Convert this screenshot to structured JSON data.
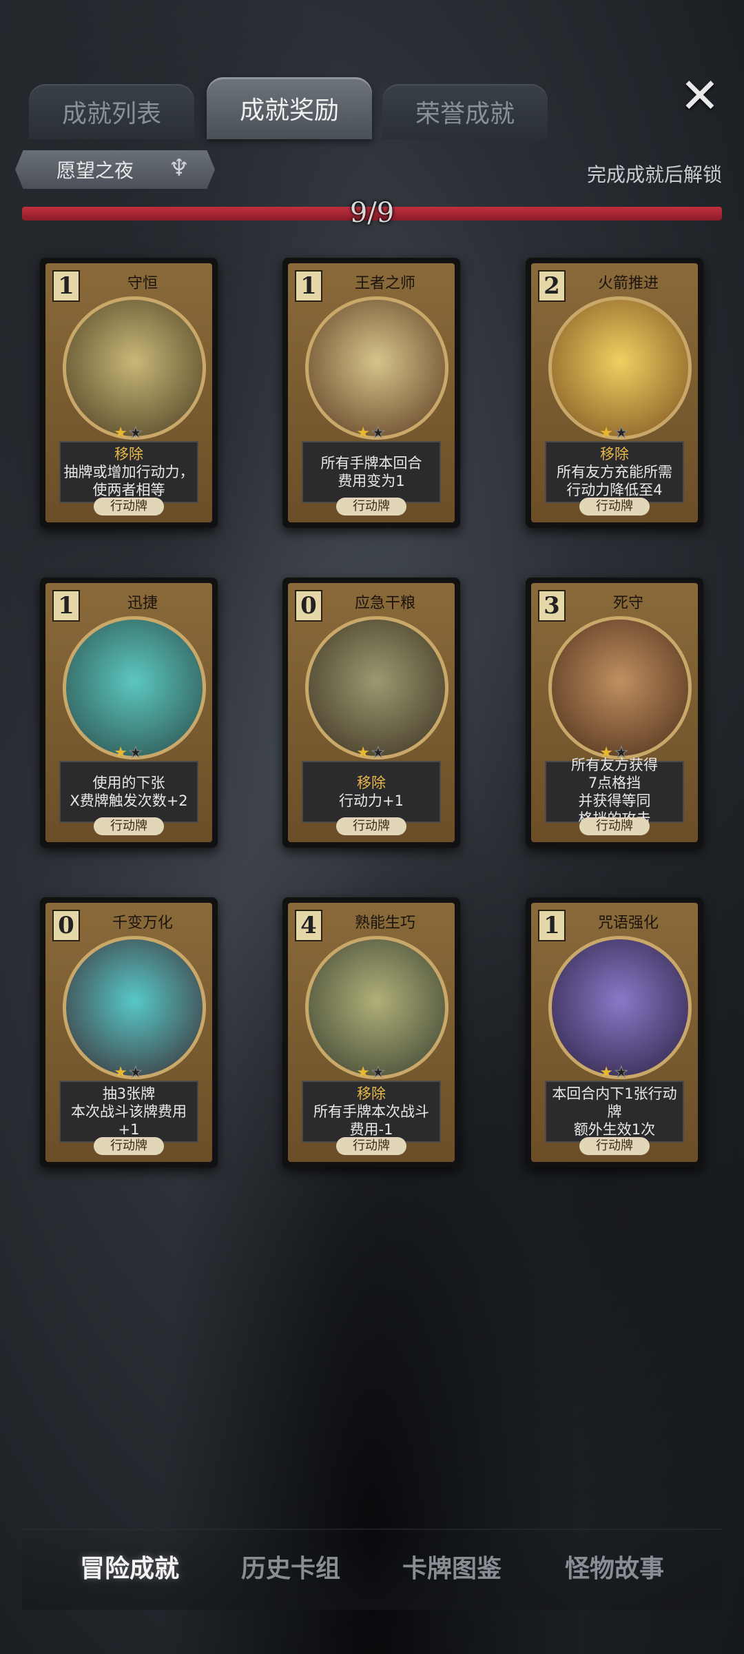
{
  "tabs": [
    {
      "label": "成就列表",
      "active": false
    },
    {
      "label": "成就奖励",
      "active": true
    },
    {
      "label": "荣誉成就",
      "active": false
    }
  ],
  "close_icon": "close-icon",
  "filter": {
    "label": "愿望之夜",
    "icon": "filter-emblem-icon"
  },
  "unlock_hint": "完成成就后解锁",
  "progress": {
    "text": "9/9",
    "value": 1.0
  },
  "colors": {
    "progress": "#b02838",
    "keyword": "#e8b84a",
    "card_frame": "#7a5c30"
  },
  "cards": [
    {
      "cost": "1",
      "name": "守恒",
      "stars": 1,
      "lines": [
        "移除",
        "抽牌或增加行动力，",
        "使两者相等"
      ],
      "kw": [
        0
      ],
      "type": "行动牌"
    },
    {
      "cost": "1",
      "name": "王者之师",
      "stars": 1,
      "lines": [
        "所有手牌本回合",
        "费用变为1"
      ],
      "kw": [],
      "type": "行动牌"
    },
    {
      "cost": "2",
      "name": "火箭推进",
      "stars": 1,
      "lines": [
        "移除",
        "所有友方充能所需",
        "行动力降低至4"
      ],
      "kw": [
        0
      ],
      "type": "行动牌"
    },
    {
      "cost": "1",
      "name": "迅捷",
      "stars": 1,
      "lines": [
        "使用的下张",
        "X费牌触发次数+2"
      ],
      "kw": [],
      "type": "行动牌"
    },
    {
      "cost": "0",
      "name": "应急干粮",
      "stars": 1,
      "lines": [
        "移除",
        "行动力+1"
      ],
      "kw": [
        0
      ],
      "type": "行动牌"
    },
    {
      "cost": "3",
      "name": "死守",
      "stars": 1,
      "lines": [
        "所有友方获得",
        "7点格挡",
        "并获得等同",
        "格挡的攻击"
      ],
      "kw": [],
      "type": "行动牌"
    },
    {
      "cost": "0",
      "name": "千变万化",
      "stars": 1,
      "lines": [
        "抽3张牌",
        "本次战斗该牌费用+1"
      ],
      "kw": [],
      "type": "行动牌"
    },
    {
      "cost": "4",
      "name": "熟能生巧",
      "stars": 1,
      "lines": [
        "移除",
        "所有手牌本次战斗",
        "费用-1"
      ],
      "kw": [
        0
      ],
      "type": "行动牌"
    },
    {
      "cost": "1",
      "name": "咒语强化",
      "stars": 1,
      "lines": [
        "本回合内下1张行动牌",
        "额外生效1次"
      ],
      "kw": [],
      "type": "行动牌"
    }
  ],
  "bottom_nav": [
    {
      "label": "冒险成就",
      "active": true
    },
    {
      "label": "历史卡组",
      "active": false
    },
    {
      "label": "卡牌图鉴",
      "active": false
    },
    {
      "label": "怪物故事",
      "active": false
    }
  ]
}
